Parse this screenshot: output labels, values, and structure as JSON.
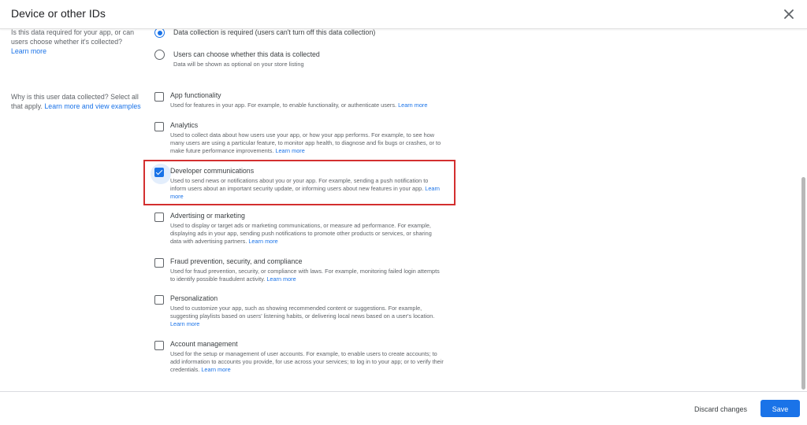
{
  "dialog": {
    "title": "Device or other IDs",
    "close_icon": "close-icon"
  },
  "required_question": {
    "label": "Is this data required for your app, or can users choose whether it's collected?",
    "link": "Learn more",
    "options": [
      {
        "label": "Data collection is required (users can't turn off this data collection)",
        "sub": "",
        "selected": true
      },
      {
        "label": "Users can choose whether this data is collected",
        "sub": "Data will be shown as optional on your store listing",
        "selected": false
      }
    ]
  },
  "purpose_question": {
    "label": "Why is this user data collected? Select all that apply.",
    "link": "Learn more and view examples",
    "options": [
      {
        "title": "App functionality",
        "desc": "Used for features in your app. For example, to enable functionality, or authenticate users.",
        "link": "Learn more",
        "checked": false
      },
      {
        "title": "Analytics",
        "desc": "Used to collect data about how users use your app, or how your app performs. For example, to see how many users are using a particular feature, to monitor app health, to diagnose and fix bugs or crashes, or to make future performance improvements.",
        "link": "Learn more",
        "checked": false
      },
      {
        "title": "Developer communications",
        "desc": "Used to send news or notifications about you or your app. For example, sending a push notification to inform users about an important security update, or informing users about new features in your app.",
        "link": "Learn more",
        "checked": true
      },
      {
        "title": "Advertising or marketing",
        "desc": "Used to display or target ads or marketing communications, or measure ad performance. For example, displaying ads in your app, sending push notifications to promote other products or services, or sharing data with advertising partners.",
        "link": "Learn more",
        "checked": false
      },
      {
        "title": "Fraud prevention, security, and compliance",
        "desc": "Used for fraud prevention, security, or compliance with laws. For example, monitoring failed login attempts to identify possible fraudulent activity.",
        "link": "Learn more",
        "checked": false
      },
      {
        "title": "Personalization",
        "desc": "Used to customize your app, such as showing recommended content or suggestions. For example, suggesting playlists based on users' listening habits, or delivering local news based on a user's location.",
        "link": "Learn more",
        "checked": false
      },
      {
        "title": "Account management",
        "desc": "Used for the setup or management of user accounts. For example, to enable users to create accounts; to add information to accounts you provide, for use across your services; to log in to your app; or to verify their credentials.",
        "link": "Learn more",
        "checked": false
      }
    ]
  },
  "footer": {
    "discard_label": "Discard changes",
    "save_label": "Save"
  },
  "colors": {
    "accent": "#1a73e8",
    "highlight": "#d32f2f"
  }
}
